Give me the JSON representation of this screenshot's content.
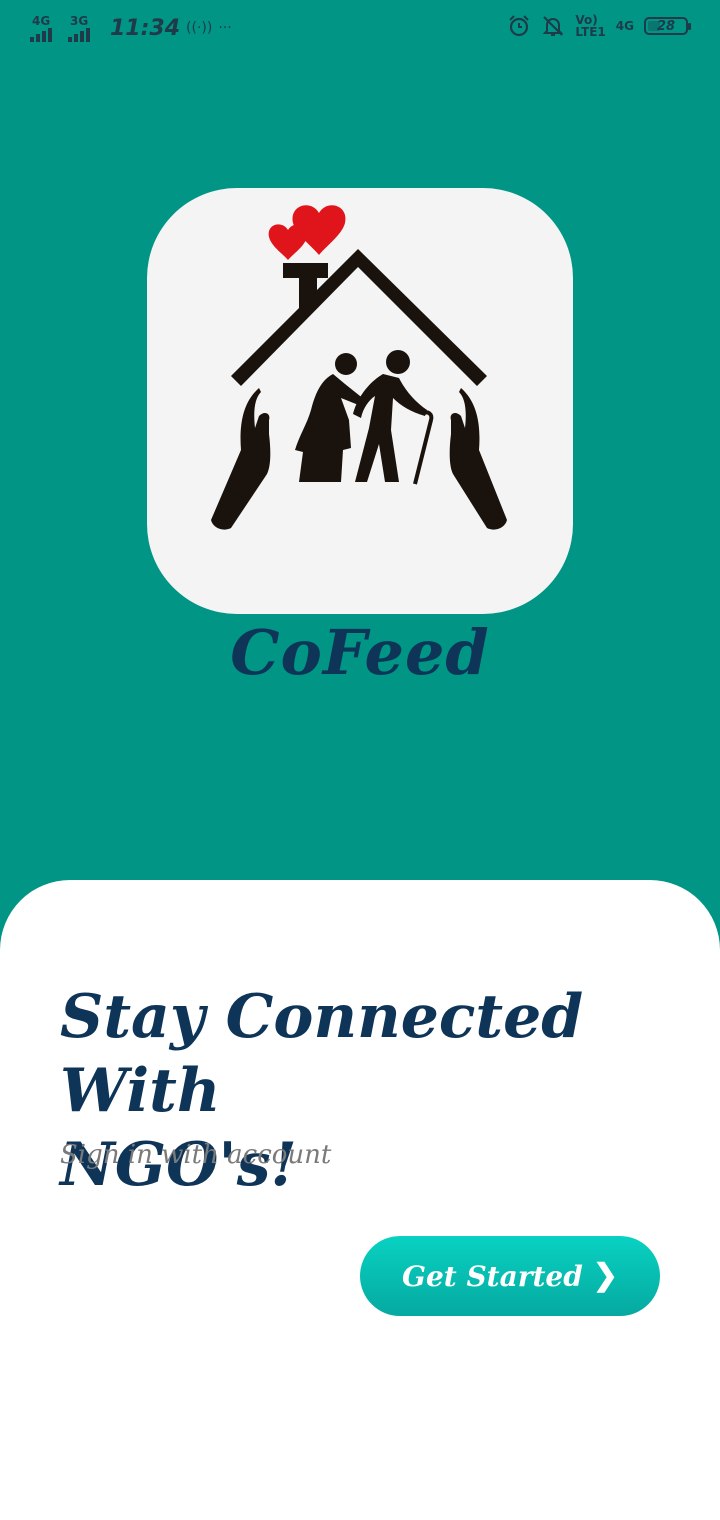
{
  "status_bar": {
    "sim1_network": "4G",
    "sim2_network": "3G",
    "time": "11:34",
    "hotspot_icon": "hotspot-icon",
    "more_glyph": "···",
    "alarm_icon": "alarm-icon",
    "mute_icon": "notifications-off-icon",
    "volte_label": "Vo)",
    "lte_label": "LTE1",
    "net_label": "4G",
    "battery_level": "28"
  },
  "app": {
    "name": "CoFeed",
    "logo_icon": "elderly-care-home-icon"
  },
  "welcome": {
    "headline_line1": "Stay Connected With",
    "headline_line2": "NGO's!",
    "subtitle": "Sign in with account"
  },
  "cta": {
    "label": "Get Started",
    "icon": "chevron-right-icon"
  },
  "colors": {
    "background": "#009585",
    "heading": "#0e3457",
    "button": "#08d2c2",
    "subtitle": "#7a7a7a",
    "heart": "#e0151b"
  }
}
